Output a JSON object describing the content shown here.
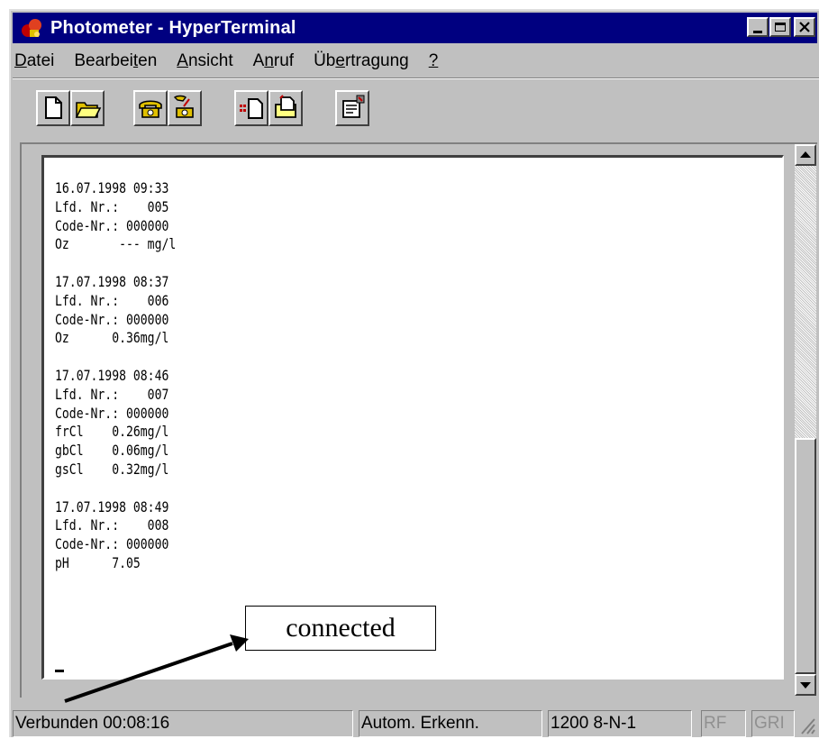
{
  "window": {
    "title": "Photometer - HyperTerminal"
  },
  "menu": {
    "items": [
      {
        "pre": "",
        "key": "D",
        "post": "atei"
      },
      {
        "pre": "Bearbei",
        "key": "t",
        "post": "en"
      },
      {
        "pre": "",
        "key": "A",
        "post": "nsicht"
      },
      {
        "pre": "A",
        "key": "n",
        "post": "ruf"
      },
      {
        "pre": "Üb",
        "key": "e",
        "post": "rtragung"
      },
      {
        "pre": "",
        "key": "?",
        "post": ""
      }
    ]
  },
  "toolbar": {
    "icons": [
      "new-document-icon",
      "open-folder-icon",
      "phone-connect-icon",
      "phone-disconnect-icon",
      "send-file-icon",
      "receive-file-icon",
      "properties-icon"
    ]
  },
  "terminal": {
    "lines": [
      "16.07.1998 09:33",
      "Lfd. Nr.:    005",
      "Code-Nr.: 000000",
      "Oz       --- mg/l",
      "",
      "17.07.1998 08:37",
      "Lfd. Nr.:    006",
      "Code-Nr.: 000000",
      "Oz      0.36mg/l",
      "",
      "17.07.1998 08:46",
      "Lfd. Nr.:    007",
      "Code-Nr.: 000000",
      "frCl    0.26mg/l",
      "gbCl    0.06mg/l",
      "gsCl    0.32mg/l",
      "",
      "17.07.1998 08:49",
      "Lfd. Nr.:    008",
      "Code-Nr.: 000000",
      "pH      7.05"
    ]
  },
  "status": {
    "connection": "Verbunden 00:08:16",
    "detect": "Autom. Erkenn.",
    "settings": "1200 8-N-1",
    "rf": "RF",
    "gr": "GRI"
  },
  "annotation": {
    "callout": "connected"
  }
}
